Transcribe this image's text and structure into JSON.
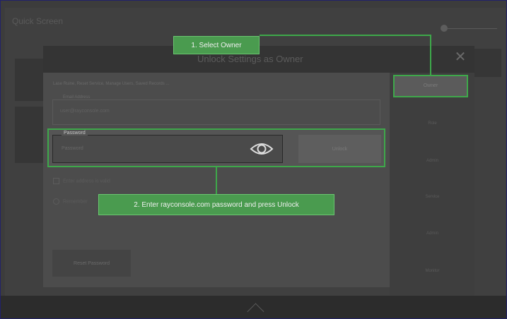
{
  "app": {
    "title": "Quick Screen"
  },
  "dialog": {
    "title": "Unlock Settings as Owner",
    "subtitle": "Lase Ruine, Reset Service, Manage Users, Saved Records ...",
    "email": {
      "legend": "Email Address",
      "value": "user@rayconsole.com"
    },
    "password": {
      "legend": "Password",
      "placeholder": "Password"
    },
    "unlock_label": "Unlock",
    "checkbox_label": "Enter address is valid",
    "radio_label": "Remember",
    "reset_label": "Reset Password"
  },
  "roles": [
    "Owner",
    "Role",
    "Admin",
    "Service",
    "Admin",
    "Monitor"
  ],
  "callouts": {
    "step1": "1. Select Owner",
    "step2": "2. Enter rayconsole.com password and press Unlock"
  },
  "colors": {
    "highlight": "#3ea84a",
    "callout_bg": "#4a9b4f"
  },
  "icons": {
    "close": "close-icon",
    "eye": "eye-icon",
    "nav": "chevron-up-icon"
  }
}
